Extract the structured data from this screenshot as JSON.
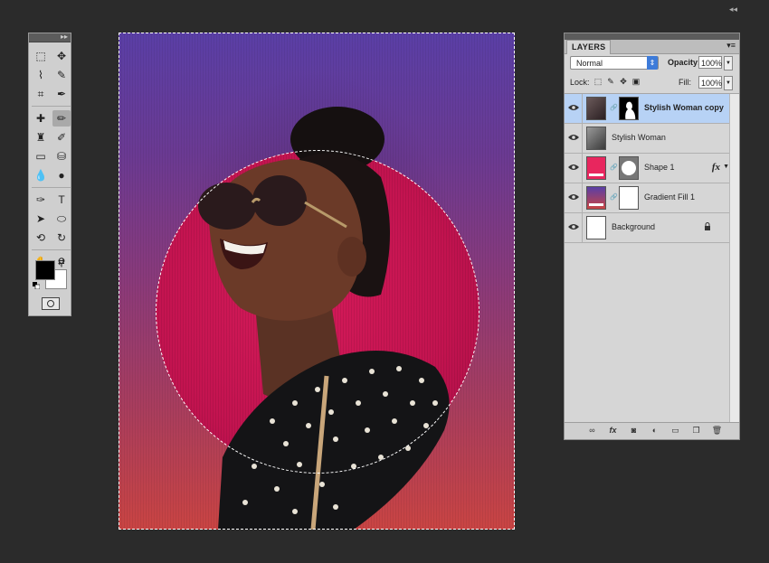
{
  "toolbox": {
    "grip_label": "▸▸",
    "tools": [
      {
        "name": "marquee-tool-icon",
        "glyph": "⬚",
        "selected": false
      },
      {
        "name": "move-tool-icon",
        "glyph": "✥",
        "selected": false
      },
      {
        "name": "lasso-tool-icon",
        "glyph": "⌇",
        "selected": false
      },
      {
        "name": "quick-selection-tool-icon",
        "glyph": "✎",
        "selected": false
      },
      {
        "name": "crop-tool-icon",
        "glyph": "⌗",
        "selected": false
      },
      {
        "name": "eyedropper-tool-icon",
        "glyph": "✒",
        "selected": false
      },
      {
        "name": "healing-brush-tool-icon",
        "glyph": "✚",
        "selected": false
      },
      {
        "name": "brush-tool-icon",
        "glyph": "✏",
        "selected": true
      },
      {
        "name": "clone-stamp-tool-icon",
        "glyph": "♜",
        "selected": false
      },
      {
        "name": "history-brush-tool-icon",
        "glyph": "✐",
        "selected": false
      },
      {
        "name": "eraser-tool-icon",
        "glyph": "▭",
        "selected": false
      },
      {
        "name": "paint-bucket-tool-icon",
        "glyph": "⛁",
        "selected": false
      },
      {
        "name": "blur-tool-icon",
        "glyph": "💧",
        "selected": false
      },
      {
        "name": "dodge-tool-icon",
        "glyph": "●",
        "selected": false
      },
      {
        "name": "pen-tool-icon",
        "glyph": "✑",
        "selected": false
      },
      {
        "name": "type-tool-icon",
        "glyph": "T",
        "selected": false
      },
      {
        "name": "path-selection-tool-icon",
        "glyph": "➤",
        "selected": false
      },
      {
        "name": "ellipse-tool-icon",
        "glyph": "⬭",
        "selected": false
      },
      {
        "name": "3d-rotate-tool-icon",
        "glyph": "⟲",
        "selected": false
      },
      {
        "name": "3d-orbit-tool-icon",
        "glyph": "↻",
        "selected": false
      },
      {
        "name": "hand-tool-icon",
        "glyph": "✋",
        "selected": false
      },
      {
        "name": "zoom-tool-icon",
        "glyph": "⚲",
        "selected": false
      }
    ],
    "foreground_color": "#000000",
    "background_color": "#ffffff"
  },
  "layers_panel": {
    "tab_label": "LAYERS",
    "blend_mode": "Normal",
    "opacity_label": "Opacity:",
    "opacity_value": "100%",
    "lock_label": "Lock:",
    "fill_label": "Fill:",
    "fill_value": "100%",
    "layers": [
      {
        "name": "Stylish Woman copy",
        "active": true,
        "has_mask": true,
        "has_fx": false,
        "locked": false,
        "thumb": "photo"
      },
      {
        "name": "Stylish Woman",
        "active": false,
        "has_mask": false,
        "has_fx": false,
        "locked": false,
        "thumb": "photo-gray"
      },
      {
        "name": "Shape 1",
        "active": false,
        "has_mask": true,
        "has_fx": true,
        "locked": false,
        "thumb": "pink"
      },
      {
        "name": "Gradient Fill 1",
        "active": false,
        "has_mask": true,
        "has_fx": false,
        "locked": false,
        "thumb": "gradient"
      },
      {
        "name": "Background",
        "active": false,
        "has_mask": false,
        "has_fx": false,
        "locked": true,
        "thumb": "white"
      }
    ],
    "fx_label": "fx",
    "bottom_icons": [
      "link-layers-icon",
      "fx-icon",
      "add-mask-icon",
      "adjustment-layer-icon",
      "new-group-icon",
      "new-layer-icon",
      "trash-icon"
    ]
  },
  "colors": {
    "app_bg": "#2b2b2b",
    "panel_bg": "#d6d6d6",
    "active_layer": "#b7d2f5",
    "circle": "#c2134f",
    "gradient_top": "#5a3fa6",
    "gradient_bottom": "#c94443"
  }
}
